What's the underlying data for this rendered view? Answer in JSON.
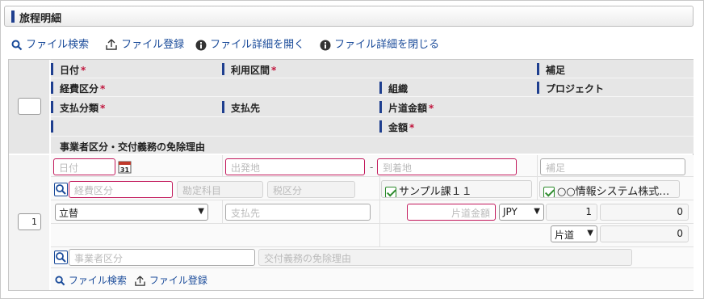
{
  "section": {
    "title": "旅程明細"
  },
  "toolbar": {
    "search": "ファイル検索",
    "register": "ファイル登録",
    "open_details": "ファイル詳細を開く",
    "close_details": "ファイル詳細を閉じる"
  },
  "headers": {
    "date": "日付",
    "route": "利用区間",
    "note": "補足",
    "expense_type": "経費区分",
    "org": "組織",
    "project": "プロジェクト",
    "payment_type": "支払分類",
    "payee": "支払先",
    "one_way_amount": "片道金額",
    "amount": "金額",
    "exemption": "事業者区分・交付義務の免除理由",
    "required_mark": "*"
  },
  "row": {
    "number": "1",
    "date_placeholder": "日付",
    "calendar_day": "31",
    "departure_placeholder": "出発地",
    "route_separator": "-",
    "arrival_placeholder": "到着地",
    "note_placeholder": "補足",
    "expense_type_placeholder": "経費区分",
    "account_placeholder": "勘定科目",
    "tax_placeholder": "税区分",
    "org_value": "サンプル課１１",
    "project_value": "○○情報システム株式…",
    "payment_type_value": "立替",
    "payee_placeholder": "支払先",
    "one_way_amount_placeholder": "片道金額",
    "currency": "JPY",
    "rate": "1",
    "one_way_total": "0",
    "trip_type": "片道",
    "amount_total": "0",
    "business_type_placeholder": "事業者区分",
    "exemption_placeholder": "交付義務の免除理由"
  },
  "row_toolbar": {
    "search": "ファイル検索",
    "register": "ファイル登録"
  },
  "colors": {
    "accent": "#1f3f8f",
    "required": "#c0143c",
    "link": "#1a4b9a",
    "check": "#2e8b2e"
  }
}
